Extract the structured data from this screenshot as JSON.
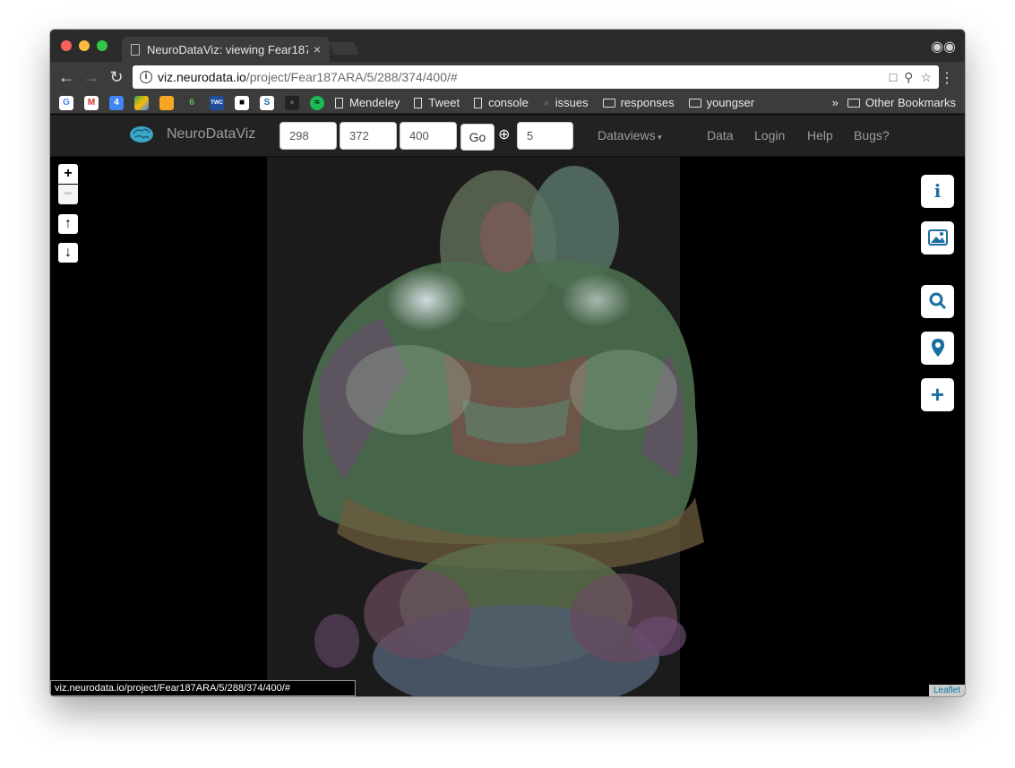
{
  "browser": {
    "tab_title": "NeuroDataViz: viewing Fear187",
    "tab_close": "×",
    "url_host": "viz.neurodata.io",
    "url_path": "/project/Fear187ARA/5/288/374/400/#",
    "bookmarks": [
      {
        "label": "Mendeley",
        "kind": "page"
      },
      {
        "label": "Tweet",
        "kind": "page"
      },
      {
        "label": "console",
        "kind": "page"
      },
      {
        "label": "issues",
        "kind": "github"
      },
      {
        "label": "responses",
        "kind": "folder"
      },
      {
        "label": "youngser",
        "kind": "folder"
      }
    ],
    "overflow_label": "»",
    "other_bookmarks": "Other Bookmarks",
    "status_url": "viz.neurodata.io/project/Fear187ARA/5/288/374/400/#"
  },
  "app": {
    "brand": "NeuroDataViz",
    "x_value": "298",
    "y_value": "372",
    "z_value": "400",
    "go_label": "Go",
    "zoom_value": "5",
    "nav": {
      "dataviews": "Dataviews",
      "data": "Data",
      "login": "Login",
      "help": "Help",
      "bugs": "Bugs?"
    }
  },
  "map": {
    "zoom_in": "+",
    "zoom_out": "−",
    "up": "↑",
    "down": "↓",
    "attribution": "Leaflet"
  },
  "icons": {
    "info": "info-icon",
    "image": "image-icon",
    "search": "search-icon",
    "marker": "map-marker-icon",
    "add": "plus-icon"
  },
  "colors": {
    "accent": "#1a6fa0",
    "navbar": "#222222"
  }
}
